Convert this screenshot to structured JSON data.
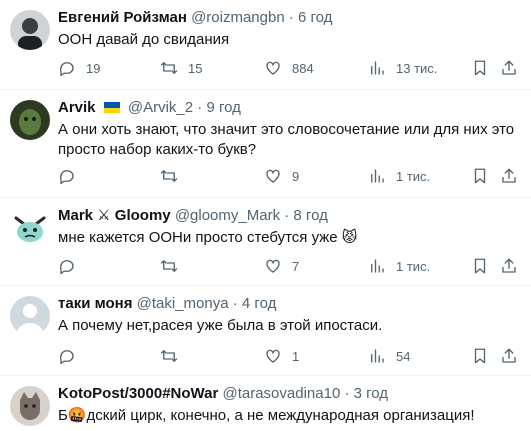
{
  "tweets": [
    {
      "name": "Евгений Ройзман",
      "handle": "@roizmangbn",
      "time": "6 год",
      "text": "ООН давай до свидания",
      "replies": "19",
      "retweets": "15",
      "likes": "884",
      "views": "13 тис."
    },
    {
      "name": "Arvik",
      "handle": "@Arvik_2",
      "time": "9 год",
      "text": "А они хоть знают, что значит это словосочетание или для них это просто набор каких-то букв?",
      "replies": "",
      "retweets": "",
      "likes": "9",
      "views": "1 тис."
    },
    {
      "name": "Mark ⚔ Gloomy",
      "handle": "@gloomy_Mark",
      "time": "8 год",
      "text": "мне кажется ООНи просто стебутся уже 😾",
      "replies": "",
      "retweets": "",
      "likes": "7",
      "views": "1 тис."
    },
    {
      "name": "таки моня",
      "handle": "@taki_monya",
      "time": "4 год",
      "text": "А почему нет,расея уже была в этой ипостаси.",
      "replies": "",
      "retweets": "",
      "likes": "1",
      "views": "54"
    },
    {
      "name": "KotoPost/3000#NoWar",
      "handle": "@tarasovadina10",
      "time": "3 год",
      "text": "Б🤬дский цирк, конечно, а не международная организация!"
    }
  ],
  "separator": "·",
  "colors": {
    "text": "#0f1419",
    "secondary": "#536471",
    "border": "#eff3f4",
    "flag_blue": "#0057b7",
    "flag_yellow": "#ffd700"
  },
  "icons": [
    "reply-icon",
    "retweet-icon",
    "like-icon",
    "views-icon",
    "bookmark-icon",
    "share-icon"
  ]
}
